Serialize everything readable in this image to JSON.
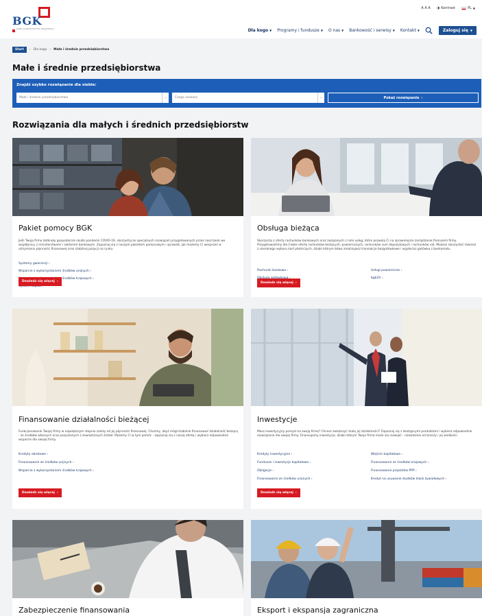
{
  "header": {
    "logo_text": "BGK",
    "logo_sub": "BANK GOSPODARSTWA KRAJOWEGO",
    "utility": {
      "font_size": "A A A",
      "contrast": "Kontrast",
      "lang": "PL"
    },
    "nav": [
      {
        "label": "Dla kogo",
        "bold": true
      },
      {
        "label": "Programy i fundusze",
        "bold": false
      },
      {
        "label": "O nas",
        "bold": false
      },
      {
        "label": "Bankowość i serwisy",
        "bold": false
      },
      {
        "label": "Kontakt",
        "bold": false
      }
    ],
    "login": "Zaloguj się"
  },
  "breadcrumb": {
    "start": "Start",
    "level1": "Dla kogo",
    "current": "Małe i średnie przedsiębiorstwa"
  },
  "page_title": "Małe i średnie przedsiębiorstwa",
  "finder": {
    "label": "Znajdź szybko rozwiązanie dla siebie:",
    "select1": "Małe i średnie przedsiębiorstwa",
    "select2": "Czego szukasz",
    "button": "Pokaż rozwiązanie"
  },
  "section_title": "Rozwiązania dla małych i średnich przedsiębiorstw",
  "cta_label": "Dowiedz się więcej",
  "cards": [
    {
      "title": "Pakiet pomocy BGK",
      "desc": "Jeśli Twoją firmę dotknęły gospodarcze skutki pandemii COVID-19, skorzystaj ze specjalnych rozwiązań przygotowanych przez nasz bank we współpracy z ministerstwami i sektorem bankowym. Zapoznaj się z naszym pakietem pomocowym i sprawdź, jak możemy Ci wesprzeć w utrzymaniu płynności finansowej oraz stabilnej pozycji na rynku.",
      "links_left": [
        "Systemy gwarancji",
        "Wsparcie z wykorzystaniem środków unijnych",
        "Wsparcie z wykorzystaniem środków krajowych",
        "System dopłat"
      ],
      "links_right": []
    },
    {
      "title": "Obsługa bieżąca",
      "desc": "Skorzystaj z oferty rachunków bankowych oraz związanych z nimi usług, które pozwolą Ci na sprawniejsze zarządzanie finansami firmy. Przygotowaliśmy dla Ciebie ofertę rachunków bieżących, powierniczych, rachunków sum depozytowych i rachunków vat. Możesz skorzystać również z szerokiego wyboru kart płatniczych, dzięki którym łatwo zrealizujesz transakcje bezgotówkowe i wypłacisz gotówkę z bankomatu.",
      "links_left": [
        "Rachunki bankowe",
        "Obsługa gotówkowa",
        "Karty płatnicze"
      ],
      "links_right": [
        "Usługi powiernicze",
        "bgk24"
      ]
    },
    {
      "title": "Finansowanie działalności bieżącej",
      "desc": "Funkcjonowanie Twojej firmy w największym stopniu zależy od jej płynności finansowej. Chcemy, abyś mógł stabilnie finansować działalność bieżącą - ze środków własnych oraz pozyskanych z zewnętrznych źródeł. Możemy Ci w tym pomóc - zapoznaj się z naszą ofertą i wybierz odpowiednie wsparcie dla swojej firmy.",
      "links_left": [
        "Kredyty obrotowe",
        "Finansowanie ze środków unijnych",
        "Wsparcie z wykorzystaniem środków krajowych"
      ],
      "links_right": []
    },
    {
      "title": "Inwestycje",
      "desc": "Masz inwestycyjny pomysł na swoją firmę? Chcesz zwiększyć skalę jej działalności? Zapoznaj się z dostępnymi produktami i wybierz odpowiednie rozwiązanie dla swojej firmy. Finansujemy inwestycje, dzięki którym Twoja firma może się rozwijać - niezależnie od branży i jej wielkości.",
      "links_left": [
        "Kredyty inwestycyjne",
        "Fundusze i inwestycje kapitałowe",
        "Obligacje",
        "Finansowanie ze środków unijnych"
      ],
      "links_right": [
        "Wejście kapitałowe",
        "Finansowanie ze środków krajowych",
        "Finansowanie projektów PPP",
        "Kredyt na usuwanie skutków klęsk żywiołowych"
      ]
    },
    {
      "title": "Zabezpieczenie finansowania"
    },
    {
      "title": "Eksport i ekspansja zagraniczna"
    }
  ]
}
